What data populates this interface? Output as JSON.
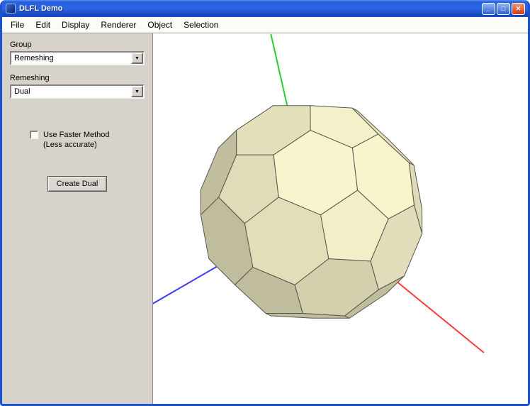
{
  "window": {
    "title": "DLFL Demo",
    "buttons": {
      "minimize": "_",
      "maximize": "□",
      "close": "✕"
    }
  },
  "menu": {
    "items": [
      "File",
      "Edit",
      "Display",
      "Renderer",
      "Object",
      "Selection"
    ]
  },
  "sidebar": {
    "group": {
      "label": "Group",
      "value": "Remeshing"
    },
    "remeshing": {
      "label": "Remeshing",
      "value": "Dual"
    },
    "checkbox": {
      "line1": "Use Faster Method",
      "line2": "(Less accurate)",
      "checked": false
    },
    "button_label": "Create Dual"
  },
  "viewport": {
    "background": "#ffffff",
    "center": [
      223,
      251
    ],
    "axes": [
      {
        "name": "y-axis-line",
        "color": "#2ecc2e",
        "end": [
          166,
          1
        ]
      },
      {
        "name": "x-axis-line",
        "color": "#ff3b3b",
        "end": [
          466,
          449
        ]
      },
      {
        "name": "z-axis-line",
        "color": "#3b3bff",
        "end": [
          -2,
          381
        ]
      }
    ],
    "mesh": {
      "fill": "#f0ecc6",
      "edge": "#57564c",
      "radius": 160
    }
  }
}
